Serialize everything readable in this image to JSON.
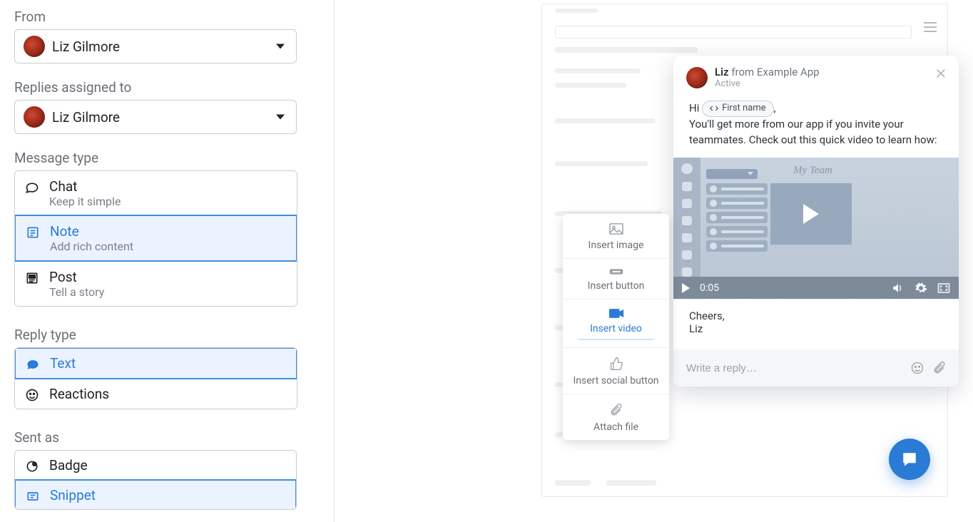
{
  "left": {
    "from_label": "From",
    "from_selected": "Liz Gilmore",
    "replies_label": "Replies assigned to",
    "replies_selected": "Liz Gilmore",
    "message_type_label": "Message type",
    "message_types": [
      {
        "title": "Chat",
        "sub": "Keep it simple"
      },
      {
        "title": "Note",
        "sub": "Add rich content"
      },
      {
        "title": "Post",
        "sub": "Tell a story"
      }
    ],
    "reply_type_label": "Reply type",
    "reply_types": [
      {
        "title": "Text"
      },
      {
        "title": "Reactions"
      }
    ],
    "sent_as_label": "Sent as",
    "sent_as": [
      {
        "title": "Badge"
      },
      {
        "title": "Snippet"
      }
    ]
  },
  "insert_menu": {
    "items": [
      "Insert image",
      "Insert button",
      "Insert video",
      "Insert social button",
      "Attach file"
    ]
  },
  "messenger": {
    "sender_name": "Liz",
    "sender_from": " from Example App",
    "status": "Active",
    "greeting_pre": "Hi ",
    "chip_label": "First name",
    "greeting_post": ",",
    "body_text": "You'll get more from our app if you invite your teammates. Check out this quick video to learn how:",
    "video": {
      "team_title": "My Team",
      "time": "0:05"
    },
    "closing_line1": "Cheers,",
    "closing_line2": "Liz",
    "reply_placeholder": "Write a reply…"
  }
}
